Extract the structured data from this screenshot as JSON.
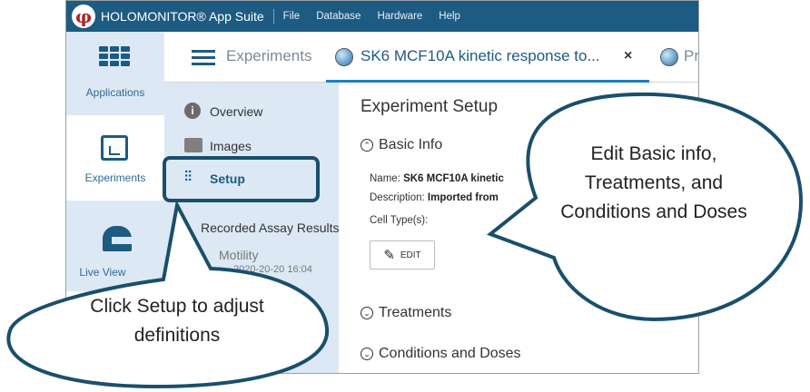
{
  "titlebar": {
    "app_title": "HOLOMONITOR® App Suite",
    "menu": [
      "File",
      "Database",
      "Hardware",
      "Help"
    ]
  },
  "appnav": {
    "applications": "Applications",
    "experiments": "Experiments",
    "live_view": "Live View"
  },
  "tabs": {
    "experiments": "Experiments",
    "active": "SK6 MCF10A kinetic response to...",
    "close": "×",
    "second": "Proli"
  },
  "expnav": {
    "overview": "Overview",
    "images": "Images",
    "setup": "Setup",
    "recorded_results": "Recorded Assay Results",
    "motility": "Motility",
    "motility_date": "2020-20-20 16:04"
  },
  "main": {
    "title": "Experiment Setup",
    "basic_info": "Basic Info",
    "name_label": "Name:",
    "name_value": "SK6 MCF10A kinetic",
    "description_label": "Description:",
    "description_value": "Imported from",
    "cell_type_label": "Cell Type(s):",
    "edit_label": "EDIT",
    "treatments": "Treatments",
    "conditions": "Conditions and Doses"
  },
  "callouts": {
    "left": "Click Setup to adjust definitions",
    "right": "Edit Basic info, Treatments, and Conditions and Doses"
  },
  "colors": {
    "titlebar": "#1d5b82",
    "nav_background": "#dce9f4",
    "callout_border": "#1a4f6b",
    "active_tab_underline": "#1d7fc1"
  }
}
